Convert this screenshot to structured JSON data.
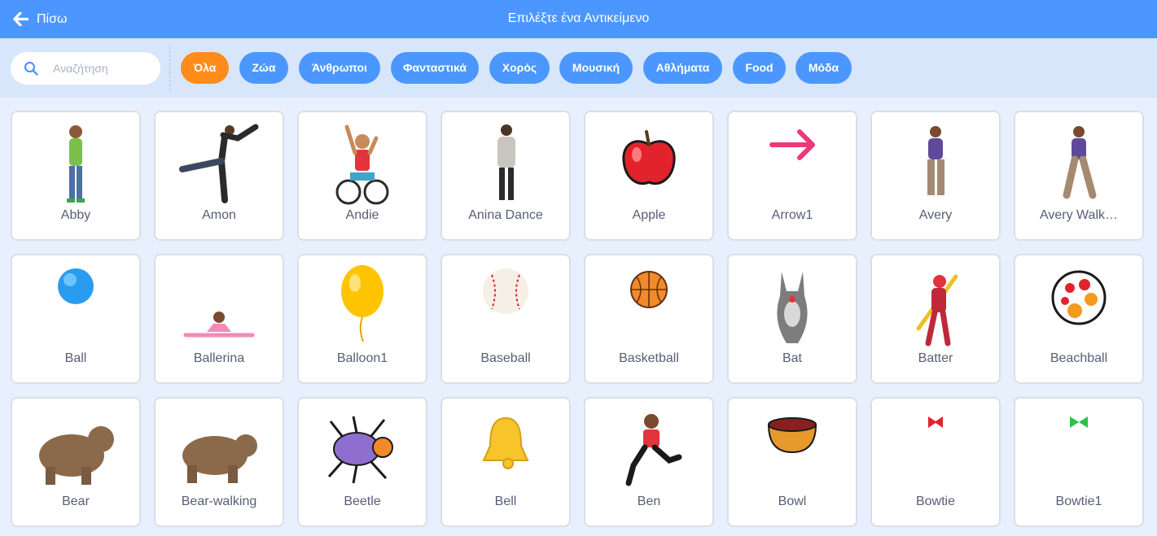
{
  "header": {
    "back_label": "Πίσω",
    "title": "Επιλέξτε ένα Αντικείμενο"
  },
  "search": {
    "placeholder": "Αναζήτηση"
  },
  "filters": [
    "Όλα",
    "Ζώα",
    "Άνθρωποι",
    "Φανταστικά",
    "Χορός",
    "Μουσική",
    "Αθλήματα",
    "Food",
    "Μόδα"
  ],
  "active_filter": "Όλα",
  "colors": {
    "header": "#4c97ff",
    "chip": "#4c97ff",
    "active_chip": "#ff8c1a",
    "label": "#575e75"
  },
  "sprites": [
    {
      "name": "Abby",
      "icon": "girl-icon"
    },
    {
      "name": "Amon",
      "icon": "dancer-man-icon"
    },
    {
      "name": "Andie",
      "icon": "wheelchair-icon"
    },
    {
      "name": "Anina Dance",
      "icon": "dancer-woman-icon"
    },
    {
      "name": "Apple",
      "icon": "apple-icon"
    },
    {
      "name": "Arrow1",
      "icon": "arrow-icon"
    },
    {
      "name": "Avery",
      "icon": "girl-icon"
    },
    {
      "name": "Avery Walk…",
      "icon": "girl-walking-icon"
    },
    {
      "name": "Ball",
      "icon": "ball-icon"
    },
    {
      "name": "Ballerina",
      "icon": "ballerina-icon"
    },
    {
      "name": "Balloon1",
      "icon": "balloon-icon"
    },
    {
      "name": "Baseball",
      "icon": "baseball-icon"
    },
    {
      "name": "Basketball",
      "icon": "basketball-icon"
    },
    {
      "name": "Bat",
      "icon": "bat-icon"
    },
    {
      "name": "Batter",
      "icon": "batter-icon"
    },
    {
      "name": "Beachball",
      "icon": "beachball-icon"
    },
    {
      "name": "Bear",
      "icon": "bear-icon"
    },
    {
      "name": "Bear-walking",
      "icon": "bear-walking-icon"
    },
    {
      "name": "Beetle",
      "icon": "beetle-icon"
    },
    {
      "name": "Bell",
      "icon": "bell-icon"
    },
    {
      "name": "Ben",
      "icon": "boy-running-icon"
    },
    {
      "name": "Bowl",
      "icon": "bowl-icon"
    },
    {
      "name": "Bowtie",
      "icon": "bowtie-icon"
    },
    {
      "name": "Bowtie1",
      "icon": "bowtie-green-icon"
    }
  ]
}
